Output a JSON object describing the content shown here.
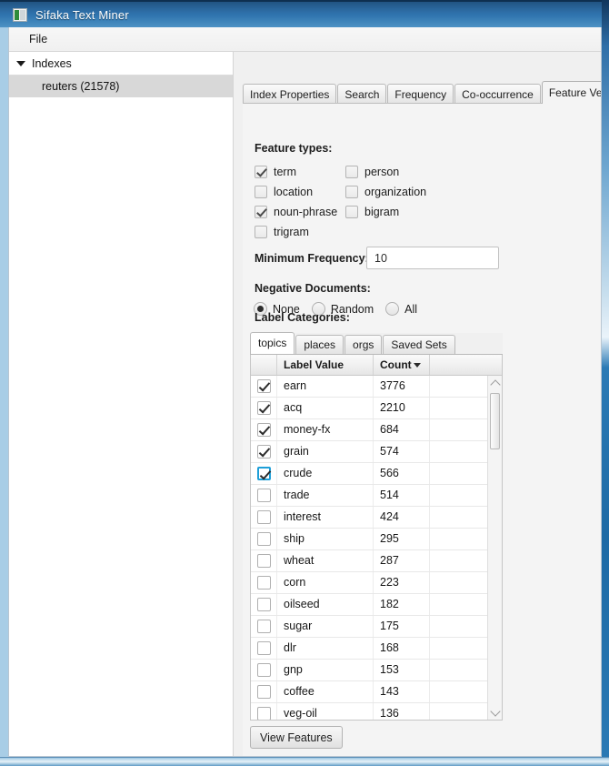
{
  "window": {
    "title": "Sifaka Text Miner",
    "icon": "app-icon"
  },
  "menubar": {
    "items": [
      {
        "label": "File"
      }
    ]
  },
  "sidebar": {
    "root": {
      "label": "Indexes",
      "expanded": true
    },
    "items": [
      {
        "label": "reuters (21578)",
        "selected": true
      }
    ]
  },
  "tabs": [
    {
      "label": "Index Properties",
      "active": false
    },
    {
      "label": "Search",
      "active": false
    },
    {
      "label": "Frequency",
      "active": false
    },
    {
      "label": "Co-occurrence",
      "active": false
    },
    {
      "label": "Feature Vectors",
      "active": true
    }
  ],
  "feature_types": {
    "label": "Feature types:",
    "options": [
      {
        "label": "term",
        "checked": true
      },
      {
        "label": "person",
        "checked": false
      },
      {
        "label": "location",
        "checked": false
      },
      {
        "label": "organization",
        "checked": false
      },
      {
        "label": "noun-phrase",
        "checked": true
      },
      {
        "label": "bigram",
        "checked": false
      },
      {
        "label": "trigram",
        "checked": false
      }
    ]
  },
  "minimum_frequency": {
    "label": "Minimum Frequency:",
    "value": "10",
    "placeholder": ""
  },
  "negative_documents": {
    "label": "Negative Documents:",
    "options": [
      {
        "label": "None",
        "selected": true
      },
      {
        "label": "Random",
        "selected": false
      },
      {
        "label": "All",
        "selected": false
      }
    ]
  },
  "label_categories": {
    "label": "Label Categories:",
    "tabs": [
      {
        "label": "topics",
        "active": true
      },
      {
        "label": "places",
        "active": false
      },
      {
        "label": "orgs",
        "active": false
      },
      {
        "label": "Saved Sets",
        "active": false
      }
    ],
    "columns": [
      {
        "label": "",
        "key": "checked"
      },
      {
        "label": "Label Value",
        "key": "label"
      },
      {
        "label": "Count",
        "key": "count",
        "sort": "desc",
        "sort_glyph": "▼"
      },
      {
        "label": "",
        "key": "extra"
      }
    ],
    "rows": [
      {
        "checked": true,
        "focused": false,
        "label": "earn",
        "count": "3776"
      },
      {
        "checked": true,
        "focused": false,
        "label": "acq",
        "count": "2210"
      },
      {
        "checked": true,
        "focused": false,
        "label": "money-fx",
        "count": "684"
      },
      {
        "checked": true,
        "focused": false,
        "label": "grain",
        "count": "574"
      },
      {
        "checked": true,
        "focused": true,
        "label": "crude",
        "count": "566"
      },
      {
        "checked": false,
        "focused": false,
        "label": "trade",
        "count": "514"
      },
      {
        "checked": false,
        "focused": false,
        "label": "interest",
        "count": "424"
      },
      {
        "checked": false,
        "focused": false,
        "label": "ship",
        "count": "295"
      },
      {
        "checked": false,
        "focused": false,
        "label": "wheat",
        "count": "287"
      },
      {
        "checked": false,
        "focused": false,
        "label": "corn",
        "count": "223"
      },
      {
        "checked": false,
        "focused": false,
        "label": "oilseed",
        "count": "182"
      },
      {
        "checked": false,
        "focused": false,
        "label": "sugar",
        "count": "175"
      },
      {
        "checked": false,
        "focused": false,
        "label": "dlr",
        "count": "168"
      },
      {
        "checked": false,
        "focused": false,
        "label": "gnp",
        "count": "153"
      },
      {
        "checked": false,
        "focused": false,
        "label": "coffee",
        "count": "143"
      },
      {
        "checked": false,
        "focused": false,
        "label": "veg-oil",
        "count": "136"
      }
    ]
  },
  "actions": {
    "view_features_label": "View Features"
  },
  "colors": {
    "titlebar_blue": "#2e6fa8",
    "focus_blue": "#1e9fd8",
    "selection_gray": "#d8d8d8",
    "panel_bg": "#f0f0f0",
    "tab_active_bg": "#f4f4f4"
  }
}
